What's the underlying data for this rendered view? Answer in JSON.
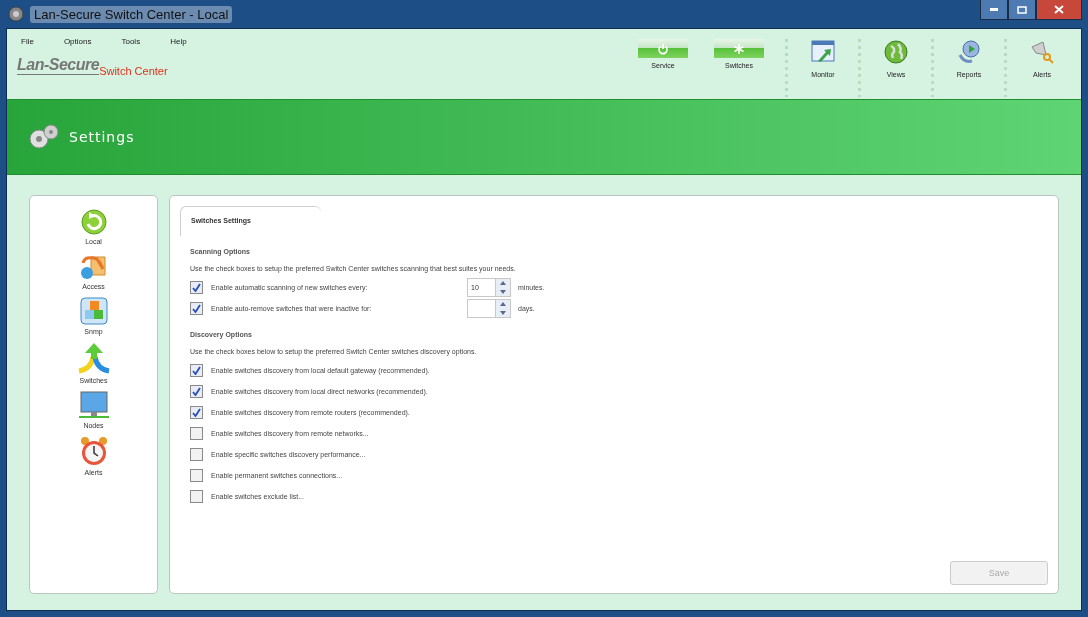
{
  "window": {
    "title": "Lan-Secure Switch Center - Local"
  },
  "menu": [
    "File",
    "Options",
    "Tools",
    "Help"
  ],
  "logo": {
    "brand": "Lan-Secure",
    "product": "Switch Center"
  },
  "toolbar": [
    {
      "label": "Service",
      "kind": "toggle"
    },
    {
      "label": "Switches",
      "kind": "toggle"
    },
    {
      "label": "Monitor",
      "kind": "icon"
    },
    {
      "label": "Views",
      "kind": "icon"
    },
    {
      "label": "Reports",
      "kind": "icon"
    },
    {
      "label": "Alerts",
      "kind": "icon"
    }
  ],
  "banner": {
    "title": "Settings"
  },
  "sidebar": {
    "items": [
      {
        "label": "Local"
      },
      {
        "label": "Access"
      },
      {
        "label": "Snmp"
      },
      {
        "label": "Switches"
      },
      {
        "label": "Nodes"
      },
      {
        "label": "Alerts"
      }
    ]
  },
  "tabs": [
    {
      "label": "Switches Settings",
      "selected": true
    }
  ],
  "sections": [
    {
      "heading": "Scanning Options",
      "description": "Use the check boxes to setup the preferred Switch Center switches scanning that best suites your needs.",
      "options": [
        {
          "kind": "spin",
          "label": "Enable automatic scanning of new switches every:",
          "checked": true,
          "value": "10",
          "unit": "minutes."
        },
        {
          "kind": "spin",
          "label": "Enable auto-remove switches that were inactive for:",
          "checked": true,
          "unit": "days."
        }
      ]
    },
    {
      "heading": "Discovery Options",
      "description": "Use the check boxes below to setup the preferred Switch Center switches discovery options.",
      "options": [
        {
          "kind": "plain",
          "label": "Enable switches discovery from local default gateway (recommended).",
          "checked": true
        },
        {
          "kind": "plain",
          "label": "Enable switches discovery from local direct networks (recommended).",
          "checked": true
        },
        {
          "kind": "plain",
          "label": "Enable switches discovery from remote routers (recommended).",
          "checked": true
        },
        {
          "kind": "plain",
          "label": "Enable switches discovery from remote networks...",
          "checked": false
        },
        {
          "kind": "plain",
          "label": "Enable specific switches discovery performance...",
          "checked": false
        },
        {
          "kind": "plain",
          "label": "Enable permanent switches connections...",
          "checked": false
        },
        {
          "kind": "plain",
          "label": "Enable switches exclude list...",
          "checked": false
        }
      ]
    }
  ],
  "save_button": {
    "label": "Save",
    "disabled": true
  }
}
